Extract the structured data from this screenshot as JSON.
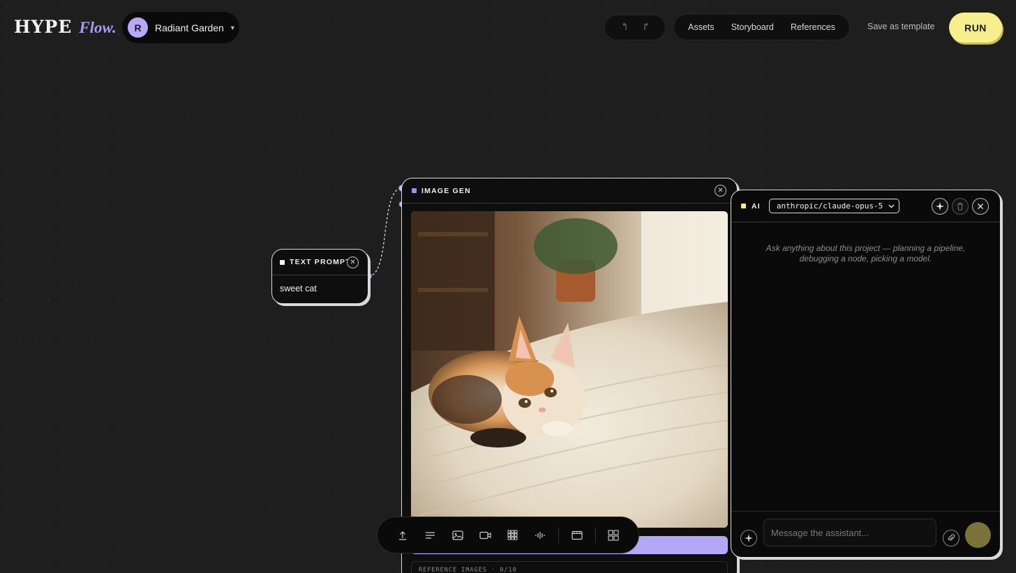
{
  "header": {
    "logo_main": "HYPE",
    "logo_flow": "Flow.",
    "project": {
      "avatar_letter": "R",
      "name": "Radiant Garden"
    },
    "undo_icon": "undo-arrow-icon",
    "redo_icon": "redo-arrow-icon",
    "nav": {
      "assets": "Assets",
      "storyboard": "Storyboard",
      "references": "References"
    },
    "save_template": "Save as template",
    "run": "RUN"
  },
  "nodes": {
    "text_prompt": {
      "title": "TEXT PROMPT",
      "value": "sweet cat"
    },
    "image_gen": {
      "title": "IMAGE GEN",
      "reference_label": "REFERENCE IMAGES · 0/10"
    }
  },
  "toolbar": {
    "items": [
      "upload-icon",
      "text-icon",
      "image-icon",
      "video-icon",
      "grid-icon",
      "audio-icon",
      "storyboard-icon",
      "layout-icon"
    ]
  },
  "ai_panel": {
    "title": "AI",
    "model": "anthropic/claude-opus-5",
    "hint": "Ask anything about this project — planning a pipeline, debugging a node, picking a model.",
    "input_placeholder": "Message the assistant..."
  },
  "colors": {
    "accent_purple": "#b4a7f5",
    "run_yellow": "#f7ef8e",
    "background": "#1e1e1e"
  }
}
